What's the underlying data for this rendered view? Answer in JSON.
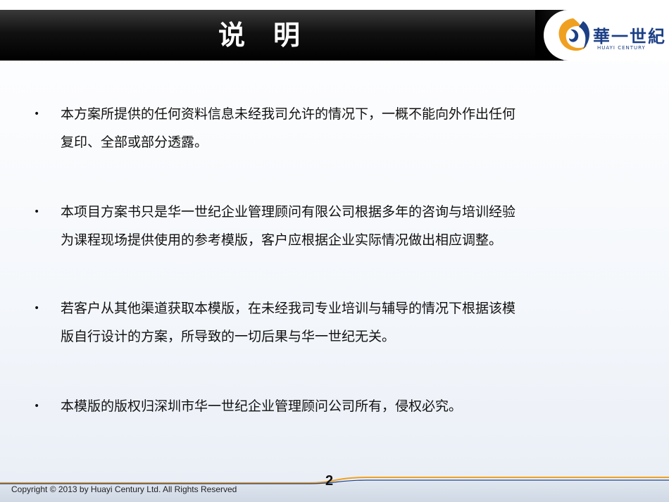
{
  "header": {
    "title": "说明",
    "logo": {
      "brand": "華一世紀",
      "subtitle": "HUAYI CENTURY"
    }
  },
  "items": [
    {
      "line1": "本方案所提供的任何资料信息未经我司允许的情况下，一概不能向外作出任何",
      "line2": "复印、全部或部分透露。"
    },
    {
      "line1": "本项目方案书只是华一世纪企业管理顾问有限公司根据多年的咨询与培训经验",
      "line2": "为课程现场提供使用的参考模版，客户应根据企业实际情况做出相应调整。"
    },
    {
      "line1": "若客户从其他渠道获取本模版，在未经我司专业培训与辅导的情况下根据该模",
      "line2": "版自行设计的方案，所导致的一切后果与华一世纪无关。"
    },
    {
      "line1": "本模版的版权归深圳市华一世纪企业管理顾问公司所有，侵权必究。",
      "line2": ""
    }
  ],
  "bullet_symbol": "•",
  "footer": {
    "copyright": "Copyright © 2013 by Huayi Century Ltd. All Rights Reserved",
    "page_number": "2"
  },
  "colors": {
    "title_bar": "#000000",
    "logo_blue": "#1c3f86",
    "accent_orange": "#f0a020"
  }
}
